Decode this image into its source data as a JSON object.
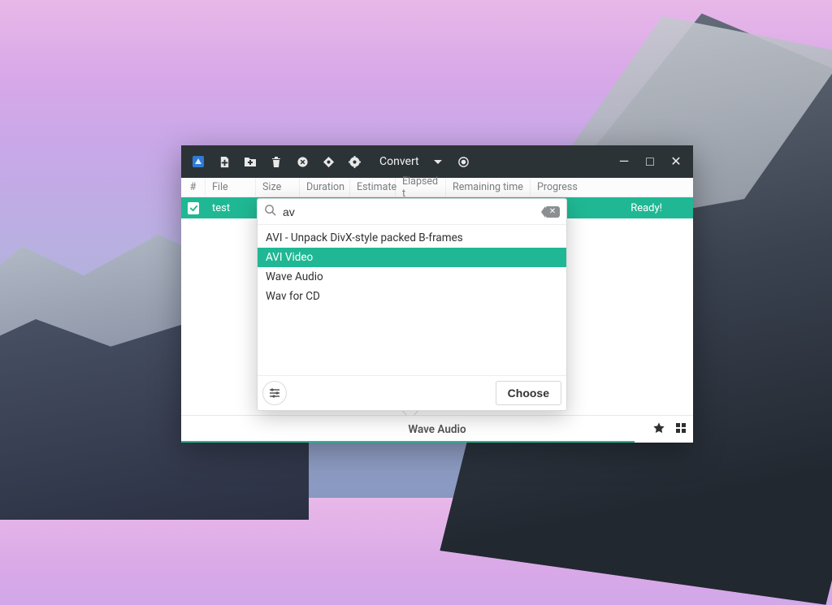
{
  "colors": {
    "accent": "#20b894",
    "titlebar": "#2c3336"
  },
  "toolbar": {
    "convert_label": "Convert",
    "icons": [
      "app",
      "add-file",
      "add-folder",
      "trash",
      "cancel",
      "diamond",
      "gear",
      "record"
    ]
  },
  "window_controls": [
    "minimize",
    "maximize",
    "close"
  ],
  "columns": {
    "num": "#",
    "file": "File",
    "size": "Size",
    "duration": "Duration",
    "estimate": "Estimate",
    "elapsed": "Elapsed t",
    "remaining": "Remaining time",
    "progress": "Progress"
  },
  "rows": [
    {
      "checked": true,
      "file": "test",
      "status": "Ready!"
    }
  ],
  "popup": {
    "search_value": "av",
    "items": [
      {
        "label": "AVI - Unpack DivX-style packed B-frames",
        "selected": false
      },
      {
        "label": "AVI Video",
        "selected": true
      },
      {
        "label": "Wave Audio",
        "selected": false
      },
      {
        "label": "Wav for CD",
        "selected": false
      }
    ],
    "choose_label": "Choose"
  },
  "bottom": {
    "current_format": "Wave Audio"
  }
}
